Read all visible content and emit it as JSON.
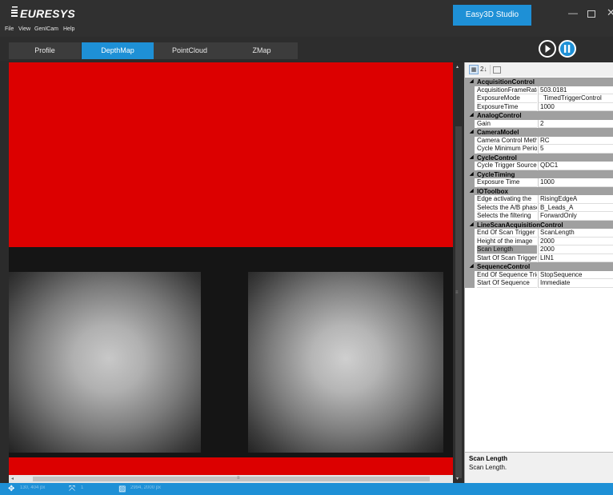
{
  "app": {
    "brand": "EURESYS",
    "window_tab": "Easy3D Studio",
    "minimize_glyph": "—",
    "close_glyph": "✕"
  },
  "menu": {
    "items": [
      "File",
      "View",
      "GenICam",
      "Help"
    ]
  },
  "view_tabs": {
    "items": [
      {
        "label": "Profile",
        "active": false
      },
      {
        "label": "DepthMap",
        "active": true
      },
      {
        "label": "PointCloud",
        "active": false
      },
      {
        "label": "ZMap",
        "active": false
      }
    ]
  },
  "controls": {
    "play_icon": "play-icon",
    "pause_icon": "pause-icon"
  },
  "property_grid": {
    "toolbar": {
      "categorized_icon": "categorized-icon",
      "sort_label": "2↓",
      "pages_icon": "property-pages-icon"
    },
    "categories": [
      {
        "name": "AcquisitionControl",
        "properties": [
          {
            "name": "AcquisitionFrameRate",
            "value": "503.0181"
          },
          {
            "name": "ExposureMode",
            "value": "TimedTriggerControl"
          },
          {
            "name": "ExposureTime",
            "value": "1000"
          }
        ]
      },
      {
        "name": "AnalogControl",
        "properties": [
          {
            "name": "Gain",
            "value": "2"
          }
        ]
      },
      {
        "name": "CameraModel",
        "properties": [
          {
            "name": "Camera Control Method",
            "value": "RC"
          },
          {
            "name": "Cycle Minimum Period",
            "value": "5"
          }
        ]
      },
      {
        "name": "CycleControl",
        "properties": [
          {
            "name": "Cycle Trigger Source",
            "value": "QDC1"
          }
        ]
      },
      {
        "name": "CycleTiming",
        "properties": [
          {
            "name": "Exposure Time",
            "value": "1000"
          }
        ]
      },
      {
        "name": "IOToolbox",
        "properties": [
          {
            "name": "Edge activating the",
            "value": "RisingEdgeA"
          },
          {
            "name": "Selects the A/B phase",
            "value": "B_Leads_A"
          },
          {
            "name": "Selects the filtering",
            "value": "ForwardOnly"
          }
        ]
      },
      {
        "name": "LineScanAcquisitionControl",
        "properties": [
          {
            "name": "End Of Scan Trigger",
            "value": "ScanLength"
          },
          {
            "name": "Height of the image",
            "value": "2000"
          },
          {
            "name": "Scan Length",
            "value": "2000"
          },
          {
            "name": "Start Of Scan Trigger",
            "value": "LIN1"
          }
        ]
      },
      {
        "name": "SequenceControl",
        "properties": [
          {
            "name": "End Of Sequence Trigger",
            "value": "StopSequence"
          },
          {
            "name": "Start Of Sequence",
            "value": "Immediate"
          }
        ]
      }
    ],
    "selected_property": "Scan Length",
    "description": {
      "title": "Scan Length",
      "text": "Scan Length."
    }
  },
  "statusbar": {
    "cursor_text": "130, 404 px",
    "zoom_text": "1",
    "size_text": "2994, 2000 px"
  },
  "colors": {
    "accent": "#1e90d6",
    "depth_invalid": "#dc0000"
  }
}
